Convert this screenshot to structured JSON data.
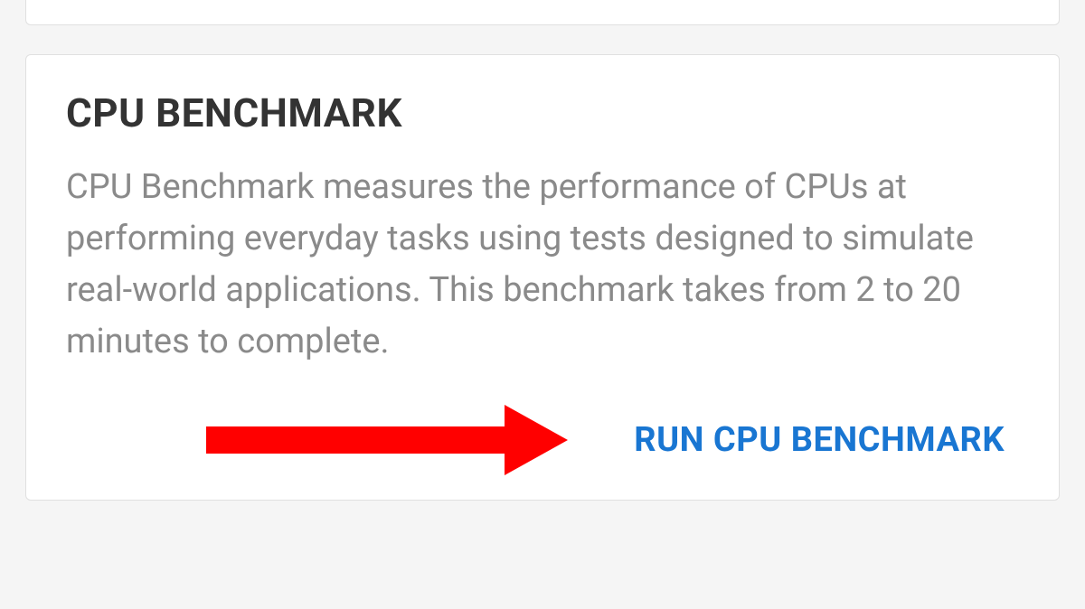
{
  "card": {
    "title": "CPU BENCHMARK",
    "description": "CPU Benchmark measures the performance of CPUs at performing everyday tasks using tests designed to simulate real-world applications. This benchmark takes from 2 to 20 minutes to complete.",
    "action_label": "RUN CPU BENCHMARK"
  },
  "colors": {
    "accent": "#1976d2",
    "annotation": "#ff0000"
  }
}
